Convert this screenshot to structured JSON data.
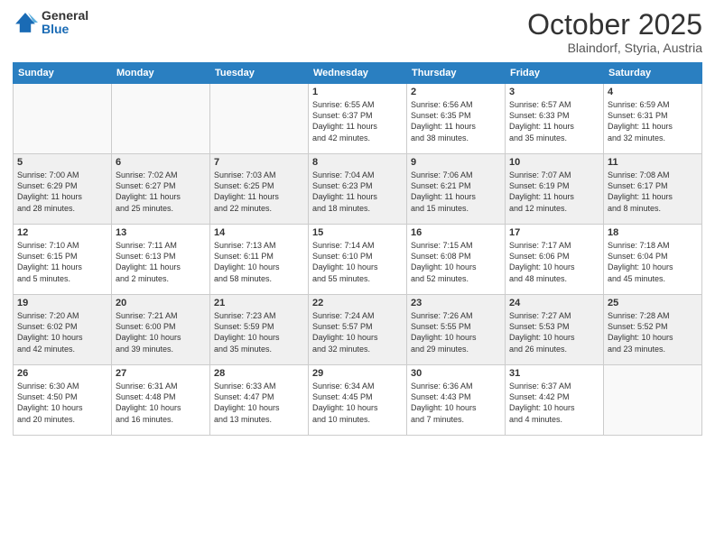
{
  "header": {
    "logo_general": "General",
    "logo_blue": "Blue",
    "month": "October 2025",
    "location": "Blaindorf, Styria, Austria"
  },
  "weekdays": [
    "Sunday",
    "Monday",
    "Tuesday",
    "Wednesday",
    "Thursday",
    "Friday",
    "Saturday"
  ],
  "weeks": [
    [
      {
        "day": "",
        "info": ""
      },
      {
        "day": "",
        "info": ""
      },
      {
        "day": "",
        "info": ""
      },
      {
        "day": "1",
        "info": "Sunrise: 6:55 AM\nSunset: 6:37 PM\nDaylight: 11 hours\nand 42 minutes."
      },
      {
        "day": "2",
        "info": "Sunrise: 6:56 AM\nSunset: 6:35 PM\nDaylight: 11 hours\nand 38 minutes."
      },
      {
        "day": "3",
        "info": "Sunrise: 6:57 AM\nSunset: 6:33 PM\nDaylight: 11 hours\nand 35 minutes."
      },
      {
        "day": "4",
        "info": "Sunrise: 6:59 AM\nSunset: 6:31 PM\nDaylight: 11 hours\nand 32 minutes."
      }
    ],
    [
      {
        "day": "5",
        "info": "Sunrise: 7:00 AM\nSunset: 6:29 PM\nDaylight: 11 hours\nand 28 minutes."
      },
      {
        "day": "6",
        "info": "Sunrise: 7:02 AM\nSunset: 6:27 PM\nDaylight: 11 hours\nand 25 minutes."
      },
      {
        "day": "7",
        "info": "Sunrise: 7:03 AM\nSunset: 6:25 PM\nDaylight: 11 hours\nand 22 minutes."
      },
      {
        "day": "8",
        "info": "Sunrise: 7:04 AM\nSunset: 6:23 PM\nDaylight: 11 hours\nand 18 minutes."
      },
      {
        "day": "9",
        "info": "Sunrise: 7:06 AM\nSunset: 6:21 PM\nDaylight: 11 hours\nand 15 minutes."
      },
      {
        "day": "10",
        "info": "Sunrise: 7:07 AM\nSunset: 6:19 PM\nDaylight: 11 hours\nand 12 minutes."
      },
      {
        "day": "11",
        "info": "Sunrise: 7:08 AM\nSunset: 6:17 PM\nDaylight: 11 hours\nand 8 minutes."
      }
    ],
    [
      {
        "day": "12",
        "info": "Sunrise: 7:10 AM\nSunset: 6:15 PM\nDaylight: 11 hours\nand 5 minutes."
      },
      {
        "day": "13",
        "info": "Sunrise: 7:11 AM\nSunset: 6:13 PM\nDaylight: 11 hours\nand 2 minutes."
      },
      {
        "day": "14",
        "info": "Sunrise: 7:13 AM\nSunset: 6:11 PM\nDaylight: 10 hours\nand 58 minutes."
      },
      {
        "day": "15",
        "info": "Sunrise: 7:14 AM\nSunset: 6:10 PM\nDaylight: 10 hours\nand 55 minutes."
      },
      {
        "day": "16",
        "info": "Sunrise: 7:15 AM\nSunset: 6:08 PM\nDaylight: 10 hours\nand 52 minutes."
      },
      {
        "day": "17",
        "info": "Sunrise: 7:17 AM\nSunset: 6:06 PM\nDaylight: 10 hours\nand 48 minutes."
      },
      {
        "day": "18",
        "info": "Sunrise: 7:18 AM\nSunset: 6:04 PM\nDaylight: 10 hours\nand 45 minutes."
      }
    ],
    [
      {
        "day": "19",
        "info": "Sunrise: 7:20 AM\nSunset: 6:02 PM\nDaylight: 10 hours\nand 42 minutes."
      },
      {
        "day": "20",
        "info": "Sunrise: 7:21 AM\nSunset: 6:00 PM\nDaylight: 10 hours\nand 39 minutes."
      },
      {
        "day": "21",
        "info": "Sunrise: 7:23 AM\nSunset: 5:59 PM\nDaylight: 10 hours\nand 35 minutes."
      },
      {
        "day": "22",
        "info": "Sunrise: 7:24 AM\nSunset: 5:57 PM\nDaylight: 10 hours\nand 32 minutes."
      },
      {
        "day": "23",
        "info": "Sunrise: 7:26 AM\nSunset: 5:55 PM\nDaylight: 10 hours\nand 29 minutes."
      },
      {
        "day": "24",
        "info": "Sunrise: 7:27 AM\nSunset: 5:53 PM\nDaylight: 10 hours\nand 26 minutes."
      },
      {
        "day": "25",
        "info": "Sunrise: 7:28 AM\nSunset: 5:52 PM\nDaylight: 10 hours\nand 23 minutes."
      }
    ],
    [
      {
        "day": "26",
        "info": "Sunrise: 6:30 AM\nSunset: 4:50 PM\nDaylight: 10 hours\nand 20 minutes."
      },
      {
        "day": "27",
        "info": "Sunrise: 6:31 AM\nSunset: 4:48 PM\nDaylight: 10 hours\nand 16 minutes."
      },
      {
        "day": "28",
        "info": "Sunrise: 6:33 AM\nSunset: 4:47 PM\nDaylight: 10 hours\nand 13 minutes."
      },
      {
        "day": "29",
        "info": "Sunrise: 6:34 AM\nSunset: 4:45 PM\nDaylight: 10 hours\nand 10 minutes."
      },
      {
        "day": "30",
        "info": "Sunrise: 6:36 AM\nSunset: 4:43 PM\nDaylight: 10 hours\nand 7 minutes."
      },
      {
        "day": "31",
        "info": "Sunrise: 6:37 AM\nSunset: 4:42 PM\nDaylight: 10 hours\nand 4 minutes."
      },
      {
        "day": "",
        "info": ""
      }
    ]
  ]
}
